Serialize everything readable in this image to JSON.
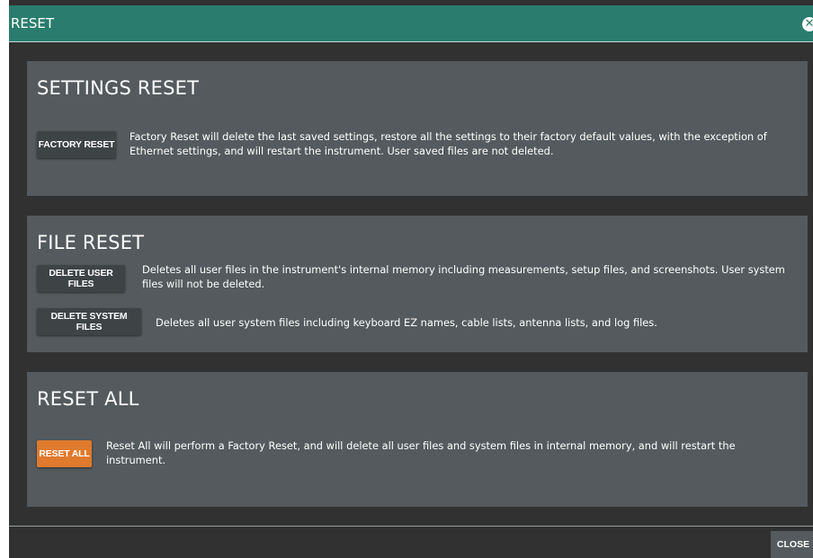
{
  "window": {
    "title": "RESET",
    "close_icon": "close-circle-icon"
  },
  "settings_reset": {
    "heading": "SETTINGS RESET",
    "factory_reset_label": "FACTORY RESET",
    "factory_reset_desc": "Factory Reset will delete the last saved settings, restore all the settings to their factory default values, with the exception of Ethernet settings, and will restart the instrument. User saved files are not deleted."
  },
  "file_reset": {
    "heading": "FILE RESET",
    "delete_user_label": "DELETE USER FILES",
    "delete_user_desc": "Deletes all user files in the instrument's internal memory including measurements, setup files, and screenshots. User system files will not be deleted.",
    "delete_system_label": "DELETE SYSTEM FILES",
    "delete_system_desc": "Deletes all user system files including keyboard EZ names, cable lists, antenna lists, and log files."
  },
  "reset_all": {
    "heading": "RESET ALL",
    "reset_all_label": "RESET ALL",
    "reset_all_desc": "Reset All will perform a Factory Reset, and will delete all user files and system files in internal memory, and will restart the instrument."
  },
  "footer": {
    "close_label": "CLOSE"
  },
  "colors": {
    "titlebar": "#2a7d6e",
    "panel": "#545a5d",
    "background": "#313131",
    "accent": "#e07a2c"
  }
}
